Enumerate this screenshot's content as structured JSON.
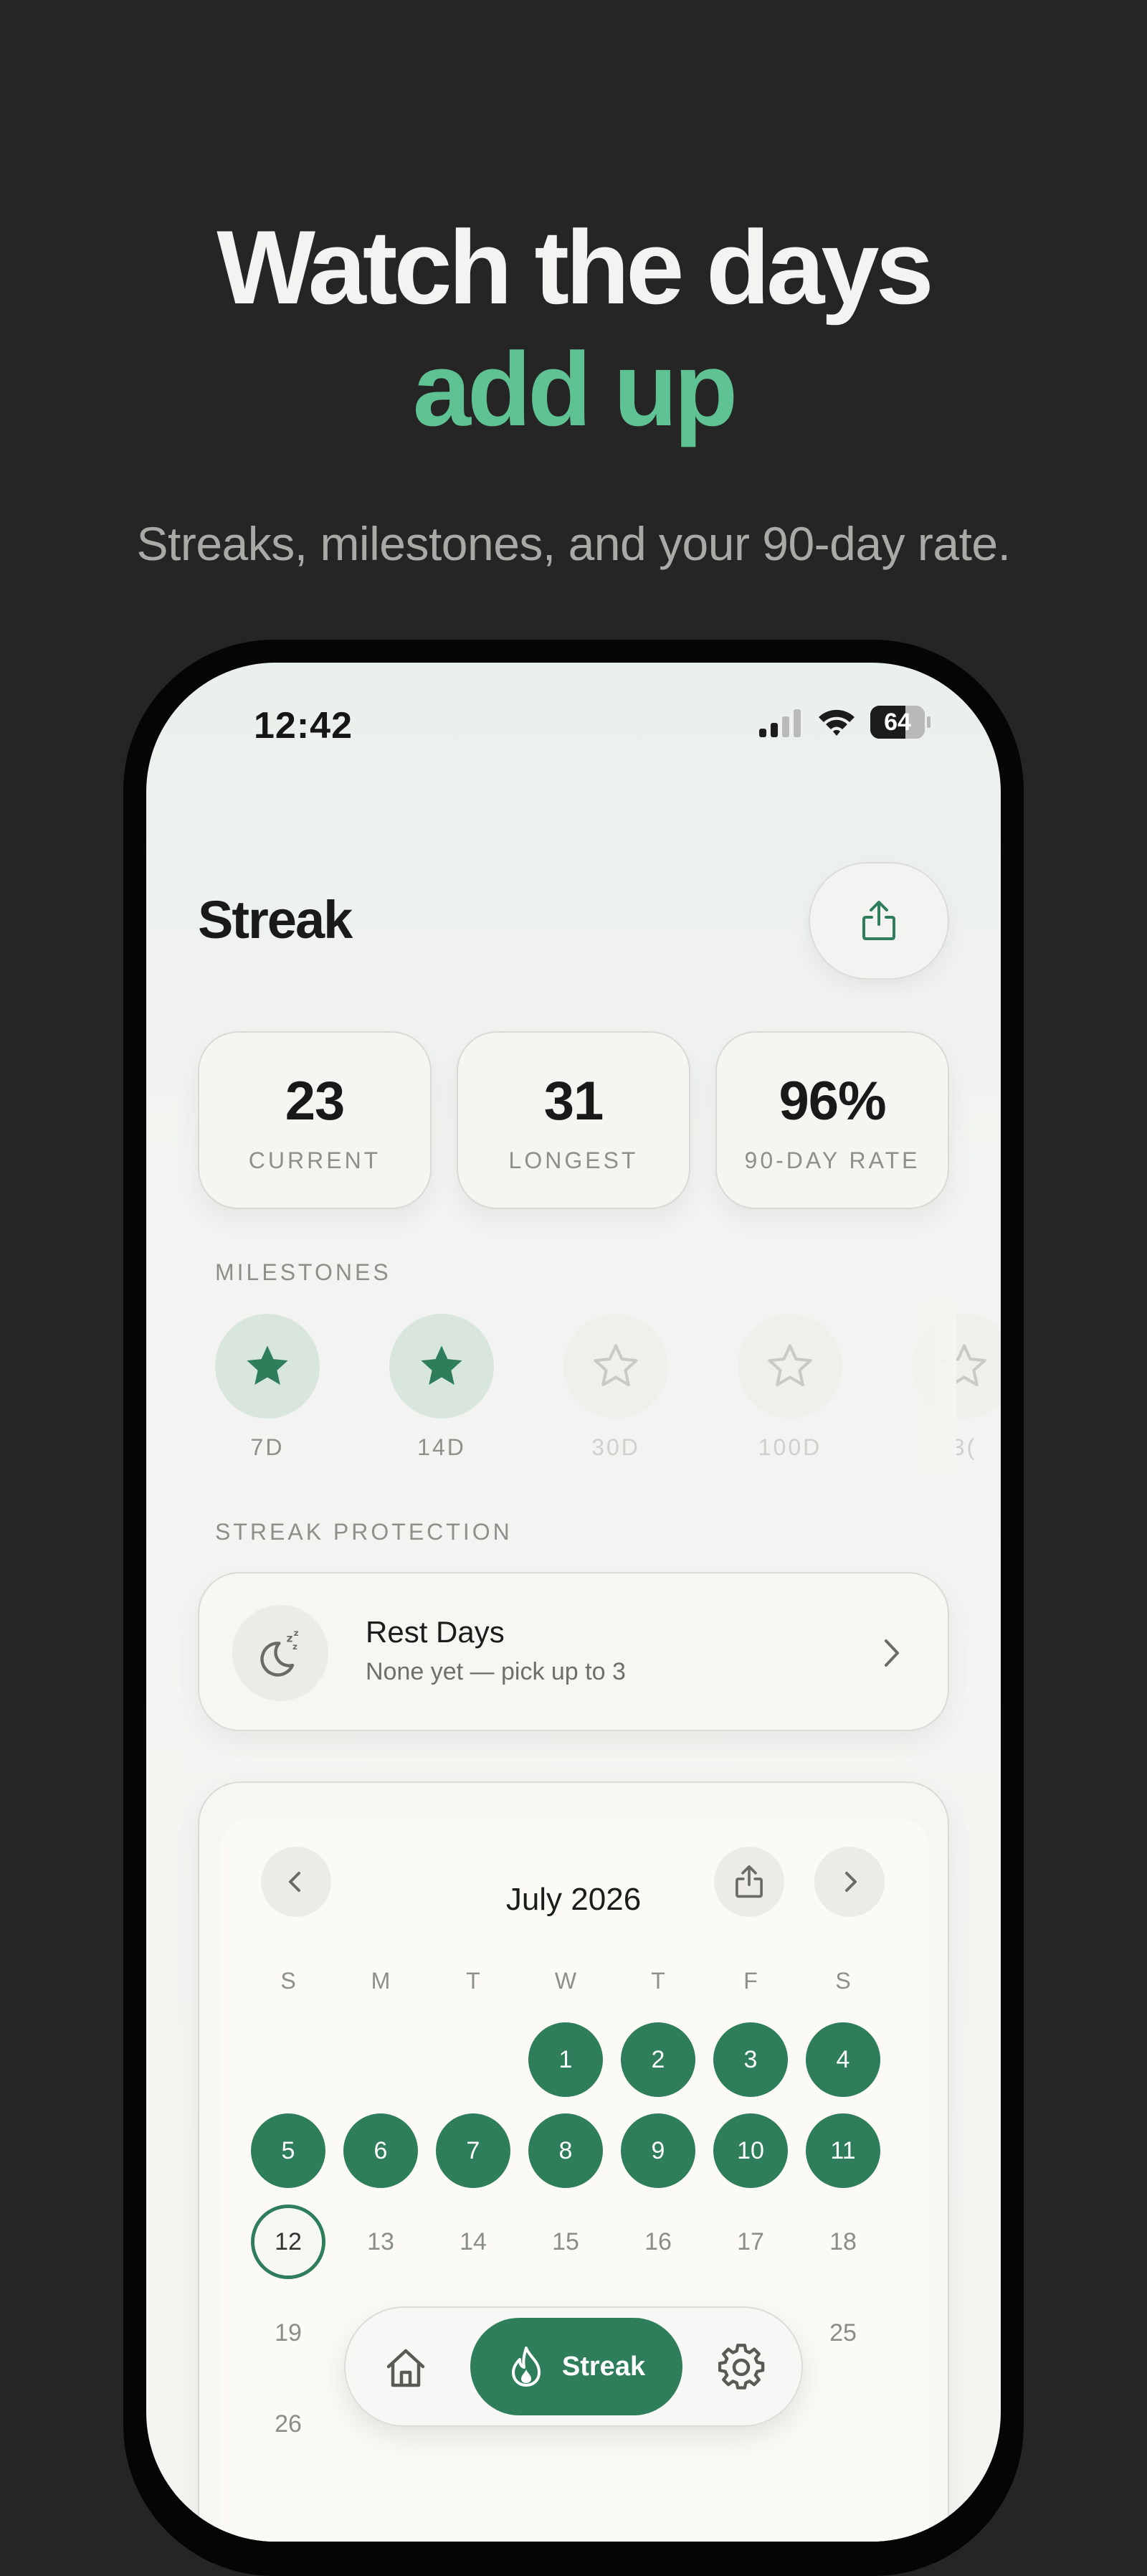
{
  "hero": {
    "line1": "Watch the days",
    "line2": "add up",
    "subtitle": "Streaks, milestones, and your 90-day rate.",
    "accent_color": "#5ec293"
  },
  "status_bar": {
    "time": "12:42",
    "battery": "64",
    "battery_level": 0.64
  },
  "header": {
    "title": "Streak",
    "share_icon": "share-icon"
  },
  "stats": [
    {
      "value": "23",
      "label": "CURRENT"
    },
    {
      "value": "31",
      "label": "LONGEST"
    },
    {
      "value": "96%",
      "label": "90-DAY RATE"
    }
  ],
  "milestones": {
    "section_label": "MILESTONES",
    "items": [
      {
        "label": "7D",
        "achieved": true,
        "icon": "star-icon"
      },
      {
        "label": "14D",
        "achieved": true,
        "icon": "star-icon"
      },
      {
        "label": "30D",
        "achieved": false,
        "icon": "star-icon"
      },
      {
        "label": "100D",
        "achieved": false,
        "icon": "star-icon"
      },
      {
        "label": "3(",
        "achieved": false,
        "icon": "star-icon"
      }
    ]
  },
  "protection": {
    "section_label": "STREAK PROTECTION",
    "title": "Rest Days",
    "subtitle": "None yet — pick up to 3",
    "icon": "moon-sleep-icon"
  },
  "calendar": {
    "month": "July 2026",
    "weekdays": [
      "S",
      "M",
      "T",
      "W",
      "T",
      "F",
      "S"
    ],
    "completed_color": "#2e7d5b",
    "rows": [
      [
        null,
        null,
        null,
        {
          "n": "1",
          "s": "done"
        },
        {
          "n": "2",
          "s": "done"
        },
        {
          "n": "3",
          "s": "done"
        },
        {
          "n": "4",
          "s": "done"
        }
      ],
      [
        {
          "n": "5",
          "s": "done"
        },
        {
          "n": "6",
          "s": "done"
        },
        {
          "n": "7",
          "s": "done"
        },
        {
          "n": "8",
          "s": "done"
        },
        {
          "n": "9",
          "s": "done"
        },
        {
          "n": "10",
          "s": "done"
        },
        {
          "n": "11",
          "s": "done"
        }
      ],
      [
        {
          "n": "12",
          "s": "today"
        },
        {
          "n": "13",
          "s": "plain"
        },
        {
          "n": "14",
          "s": "plain"
        },
        {
          "n": "15",
          "s": "plain"
        },
        {
          "n": "16",
          "s": "plain"
        },
        {
          "n": "17",
          "s": "plain"
        },
        {
          "n": "18",
          "s": "plain"
        }
      ],
      [
        {
          "n": "19",
          "s": "plain"
        },
        null,
        null,
        null,
        null,
        null,
        {
          "n": "25",
          "s": "plain"
        }
      ],
      [
        {
          "n": "26",
          "s": "plain"
        },
        null,
        null,
        null,
        null,
        null,
        null
      ]
    ]
  },
  "tab_bar": {
    "items": [
      {
        "icon": "home-icon",
        "label": ""
      },
      {
        "icon": "flame-icon",
        "label": "Streak",
        "active": true
      },
      {
        "icon": "gear-icon",
        "label": ""
      }
    ]
  }
}
